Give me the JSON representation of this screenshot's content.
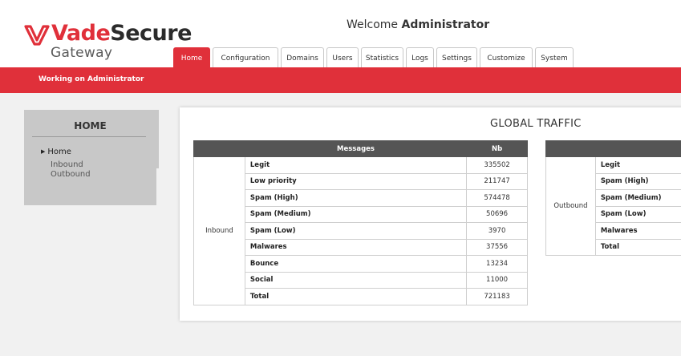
{
  "brand": {
    "name_red": "Vade",
    "name_dark": "Secure",
    "subtitle": "Gateway",
    "color": "#e0303a"
  },
  "welcome": {
    "prefix": "Welcome",
    "user": "Administrator"
  },
  "tabs": [
    {
      "label": "Home",
      "active": true
    },
    {
      "label": "Configuration",
      "active": false
    },
    {
      "label": "Domains",
      "active": false
    },
    {
      "label": "Users",
      "active": false
    },
    {
      "label": "Statistics",
      "active": false
    },
    {
      "label": "Logs",
      "active": false
    },
    {
      "label": "Settings",
      "active": false
    },
    {
      "label": "Customize",
      "active": false
    },
    {
      "label": "System",
      "active": false
    }
  ],
  "working_on": "Working on Administrator",
  "sidebar": {
    "title": "HOME",
    "items": [
      {
        "label": "Home",
        "icon": "caret-right-icon"
      },
      {
        "label": "Inbound"
      },
      {
        "label": "Outbound"
      }
    ]
  },
  "global_traffic": {
    "title": "GLOBAL TRAFFIC",
    "inbound": {
      "group_label": "Inbound",
      "headers": [
        "",
        "Messages",
        "Nb"
      ],
      "rows": [
        {
          "label": "Legit",
          "value": "335502"
        },
        {
          "label": "Low priority",
          "value": "211747"
        },
        {
          "label": "Spam (High)",
          "value": "574478"
        },
        {
          "label": "Spam (Medium)",
          "value": "50696"
        },
        {
          "label": "Spam (Low)",
          "value": "3970"
        },
        {
          "label": "Malwares",
          "value": "37556"
        },
        {
          "label": "Bounce",
          "value": "13234"
        },
        {
          "label": "Social",
          "value": "11000"
        },
        {
          "label": "Total",
          "value": "721183"
        }
      ]
    },
    "outbound": {
      "group_label": "Outbound",
      "rows": [
        {
          "label": "Legit"
        },
        {
          "label": "Spam (High)"
        },
        {
          "label": "Spam (Medium)"
        },
        {
          "label": "Spam (Low)"
        },
        {
          "label": "Malwares"
        },
        {
          "label": "Total"
        }
      ]
    }
  }
}
